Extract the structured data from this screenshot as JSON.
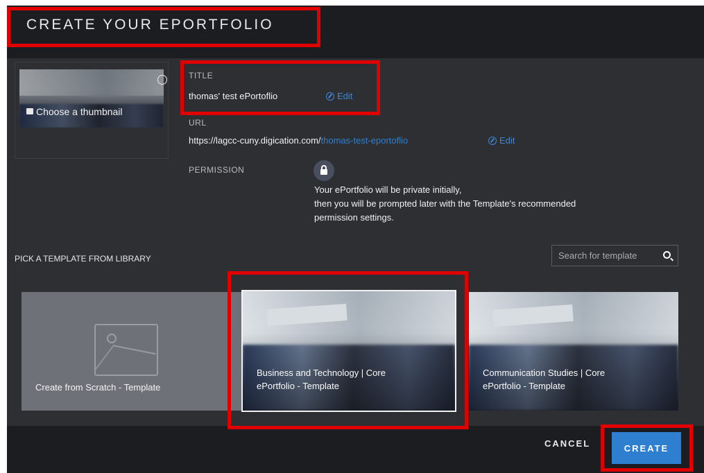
{
  "modal": {
    "title": "CREATE YOUR EPORTFOLIO",
    "thumbnail_label": "Choose a thumbnail"
  },
  "fields": {
    "title_label": "TITLE",
    "title_value": "thomas' test ePortoflio",
    "title_edit": "Edit",
    "url_label": "URL",
    "url_base": "https://lagcc-cuny.digication.com/",
    "url_slug": "thomas-test-eportoflio",
    "url_edit": "Edit",
    "permission_label": "PERMISSION",
    "permission_line1": "Your ePortfolio will be private initially,",
    "permission_line2": "then you will be prompted later with the Template's recommended",
    "permission_line3": "permission settings."
  },
  "library": {
    "label": "PICK A TEMPLATE FROM LIBRARY",
    "search_placeholder": "Search for template",
    "templates": [
      {
        "line1": "Create from Scratch - Template",
        "line2": ""
      },
      {
        "line1": "Business and Technology | Core",
        "line2": "ePortfolio - Template"
      },
      {
        "line1": "Communication Studies | Core",
        "line2": "ePortfolio - Template"
      }
    ]
  },
  "footer": {
    "cancel": "CANCEL",
    "create": "CREATE"
  },
  "colors": {
    "accent": "#2f7fd1",
    "highlight": "#e00000",
    "modal_bg": "#2d2f33",
    "header_bg": "#1c1d20"
  }
}
